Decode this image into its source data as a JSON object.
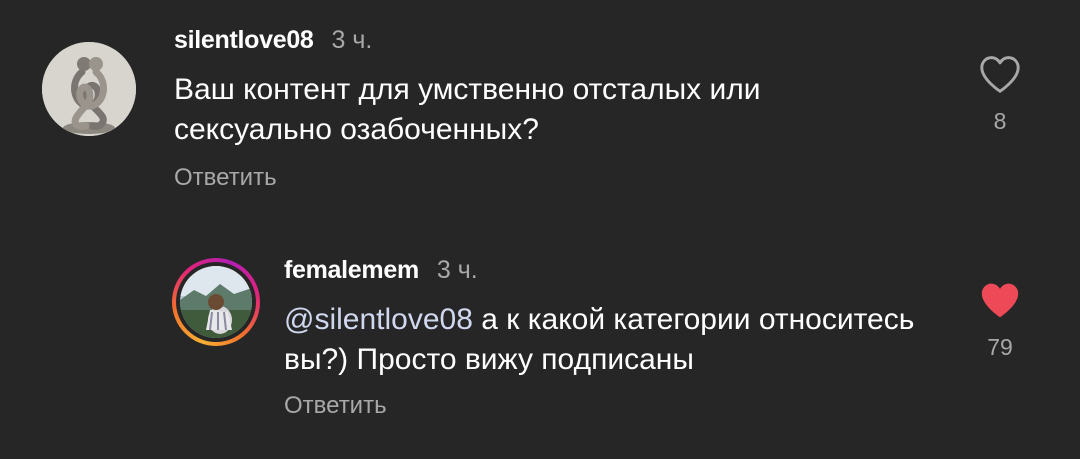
{
  "comments": [
    {
      "username": "silentlove08",
      "time": "3 ч.",
      "text": "Ваш контент для умственно отсталых или сексуально озабоченных?",
      "reply_label": "Ответить",
      "likes": "8",
      "liked": false,
      "avatar_icon": "sculpture-avatar"
    },
    {
      "username": "femalemem",
      "time": "3 ч.",
      "mention": "@silentlove08",
      "text": " а к какой категории относитесь вы?) Просто вижу подписаны",
      "reply_label": "Ответить",
      "likes": "79",
      "liked": true,
      "avatar_icon": "photo-avatar-with-story-ring"
    }
  ],
  "colors": {
    "background": "#262626",
    "secondary_text": "#a8a8a8",
    "mention": "#cfd8ee",
    "liked_heart": "#ed4956"
  }
}
